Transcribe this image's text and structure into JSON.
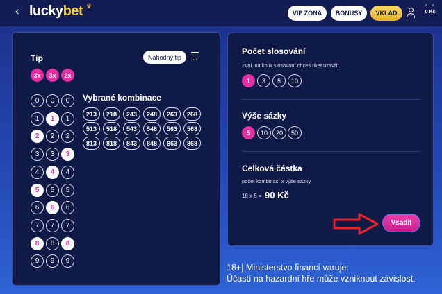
{
  "header": {
    "back_icon": "chevron-left-icon",
    "logo_part1": "lucky",
    "logo_part2": "bet",
    "vip_label": "VIP ZÓNA",
    "bonus_label": "BONUSY",
    "deposit_label": "VKLAD",
    "balance": "0 Kč",
    "colors": {
      "header_bg": "#141c54",
      "deposit_gold": "#f4c93b"
    }
  },
  "ticket": {
    "tip_label": "Tip",
    "random_tip_label": "Náhodný tip",
    "multipliers": [
      "3x",
      "3x",
      "2x"
    ],
    "columns": [
      {
        "numbers": [
          "0",
          "1",
          "2",
          "3",
          "4",
          "5",
          "6",
          "7",
          "8",
          "9"
        ],
        "selected": [
          false,
          false,
          true,
          false,
          false,
          true,
          false,
          false,
          true,
          false
        ]
      },
      {
        "numbers": [
          "0",
          "1",
          "2",
          "3",
          "4",
          "5",
          "6",
          "7",
          "8",
          "9"
        ],
        "selected": [
          false,
          true,
          false,
          false,
          true,
          false,
          true,
          false,
          false,
          false
        ]
      },
      {
        "numbers": [
          "0",
          "1",
          "2",
          "3",
          "4",
          "5",
          "6",
          "7",
          "8",
          "9"
        ],
        "selected": [
          false,
          false,
          false,
          true,
          false,
          false,
          false,
          false,
          true,
          false
        ]
      }
    ],
    "combinations_title": "Vybrané kombinace",
    "combinations": [
      [
        "213",
        "218",
        "243",
        "248",
        "263",
        "268"
      ],
      [
        "513",
        "518",
        "543",
        "548",
        "563",
        "568"
      ],
      [
        "813",
        "818",
        "843",
        "848",
        "863",
        "868"
      ]
    ]
  },
  "settings": {
    "draws_title": "Počet slosování",
    "draws_subtitle": "Zvol, na kolik slosování chceš tiket uzavřít.",
    "draws_options": [
      "1",
      "3",
      "5",
      "10"
    ],
    "draws_selected": "1",
    "stake_title": "Výše sázky",
    "stake_options": [
      "5",
      "10",
      "20",
      "50"
    ],
    "stake_selected": "5",
    "total_title": "Celková částka",
    "total_subtitle": "počet kombinací x výše sázky",
    "calc_text": "18 x 5 =",
    "total_amount": "90 Kč",
    "bet_label": "Vsadit",
    "accent_color": "#e52fa5"
  },
  "warning": {
    "line1": "18+| Ministerstvo financí varuje:",
    "line2": "Účastí na hazardní hře může vzniknout závislost."
  }
}
